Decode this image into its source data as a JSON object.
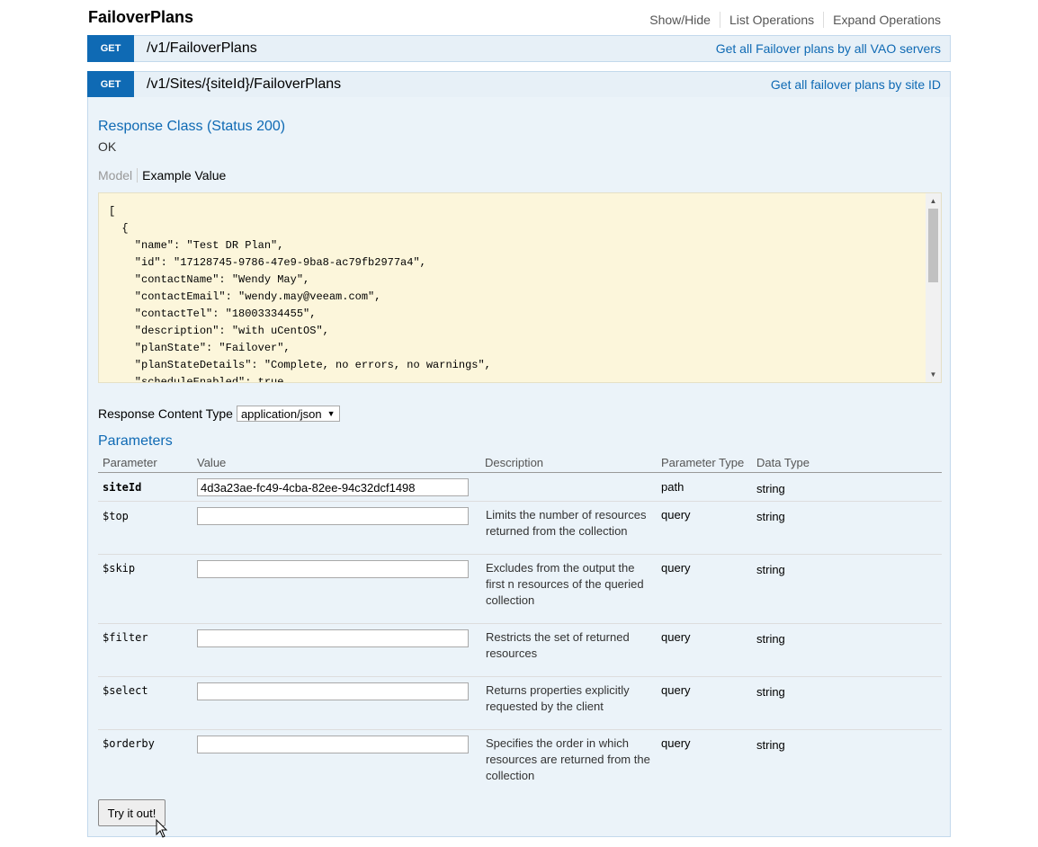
{
  "resource": {
    "title": "FailoverPlans",
    "links": [
      "Show/Hide",
      "List Operations",
      "Expand Operations"
    ]
  },
  "operations": [
    {
      "method": "GET",
      "path": "/v1/FailoverPlans",
      "summary": "Get all Failover plans by all VAO servers"
    },
    {
      "method": "GET",
      "path": "/v1/Sites/{siteId}/FailoverPlans",
      "summary": "Get all failover plans by site ID"
    }
  ],
  "response": {
    "class_heading": "Response Class (Status 200)",
    "status_text": "OK",
    "tab_model": "Model",
    "tab_example": "Example Value",
    "example_lines": [
      "[",
      "  {",
      "    \"name\": \"Test DR Plan\",",
      "    \"id\": \"17128745-9786-47e9-9ba8-ac79fb2977a4\",",
      "    \"contactName\": \"Wendy May\",",
      "    \"contactEmail\": \"wendy.may@veeam.com\",",
      "    \"contactTel\": \"18003334455\",",
      "    \"description\": \"with uCentOS\",",
      "    \"planState\": \"Failover\",",
      "    \"planStateDetails\": \"Complete, no errors, no warnings\",",
      "    \"scheduleEnabled\": true,"
    ],
    "content_type_label": "Response Content Type",
    "content_type_value": "application/json"
  },
  "parameters": {
    "heading": "Parameters",
    "columns": [
      "Parameter",
      "Value",
      "Description",
      "Parameter Type",
      "Data Type"
    ],
    "rows": [
      {
        "name": "siteId",
        "value": "4d3a23ae-fc49-4cba-82ee-94c32dcf1498",
        "description": "",
        "param_type": "path",
        "data_type": "string"
      },
      {
        "name": "$top",
        "value": "",
        "description": "Limits the number of resources returned from the collection",
        "param_type": "query",
        "data_type": "string"
      },
      {
        "name": "$skip",
        "value": "",
        "description": "Excludes from the output the first n resources of the queried collection",
        "param_type": "query",
        "data_type": "string"
      },
      {
        "name": "$filter",
        "value": "",
        "description": "Restricts the set of returned resources",
        "param_type": "query",
        "data_type": "string"
      },
      {
        "name": "$select",
        "value": "",
        "description": "Returns properties explicitly requested by the client",
        "param_type": "query",
        "data_type": "string"
      },
      {
        "name": "$orderby",
        "value": "",
        "description": "Specifies the order in which resources are returned from the collection",
        "param_type": "query",
        "data_type": "string"
      }
    ]
  },
  "try_button": "Try it out!",
  "colors": {
    "method_get": "#0f6ab4",
    "op_background": "#ebf3f9",
    "code_background": "#fcf6db"
  }
}
